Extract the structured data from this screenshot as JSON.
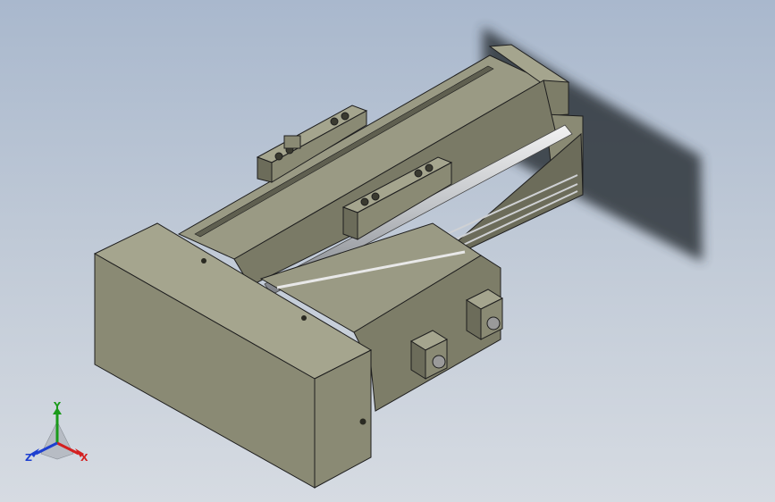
{
  "viewport": {
    "model": "linear-actuator-assembly"
  },
  "triad": {
    "x_label": "X",
    "y_label": "Y",
    "z_label": "Z",
    "colors": {
      "x": "#d42020",
      "y": "#1a9a1a",
      "z": "#1d3fd0"
    }
  },
  "colors": {
    "background_top": "#a9b8cd",
    "background_bottom": "#d6dbe2",
    "body": "#8a8a74",
    "body_dark": "#5f5f50",
    "body_light": "#a5a58e",
    "edge": "#1e1e1e",
    "shadow": "#3a3f46"
  }
}
